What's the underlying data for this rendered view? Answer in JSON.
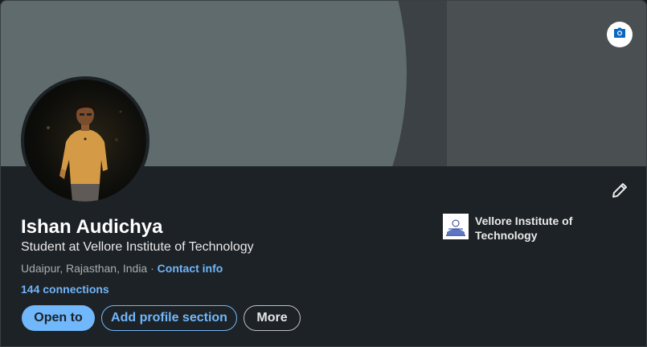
{
  "profile": {
    "name": "Ishan Audichya",
    "headline": "Student at Vellore Institute of Technology",
    "location": "Udaipur, Rajasthan, India",
    "separator": " · ",
    "contact_info_label": "Contact info",
    "connections_label": "144 connections"
  },
  "education": {
    "institution": "Vellore Institute of Technology"
  },
  "actions": {
    "open_to_label": "Open to",
    "add_section_label": "Add profile section",
    "more_label": "More"
  },
  "icons": {
    "banner_edit": "camera-icon",
    "profile_edit": "pencil-icon"
  },
  "colors": {
    "accent": "#70b5f9",
    "background": "#1d2226",
    "banner": "#5f6b6c"
  }
}
